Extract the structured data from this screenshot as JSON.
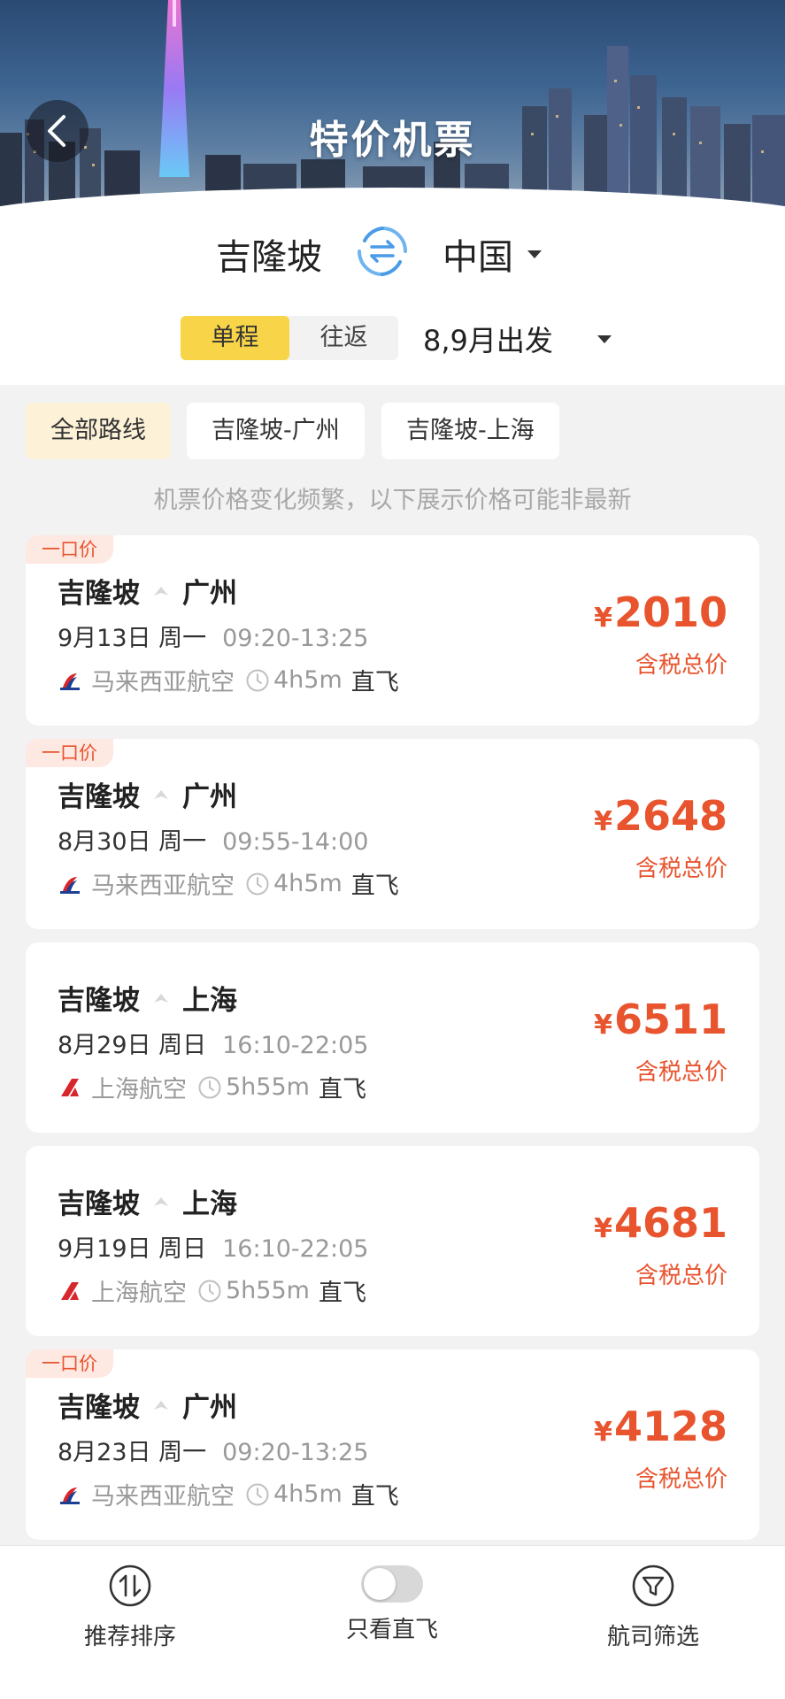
{
  "header": {
    "title": "特价机票",
    "back_icon": "back-arrow-icon"
  },
  "route_selector": {
    "from": "吉隆坡",
    "to": "中国",
    "swap_icon": "swap-arrows-icon",
    "trip_types": [
      {
        "label": "单程",
        "active": true
      },
      {
        "label": "往返",
        "active": false
      }
    ],
    "departure": "8,9月出发"
  },
  "filters": [
    {
      "label": "全部路线",
      "active": true
    },
    {
      "label": "吉隆坡-广州",
      "active": false
    },
    {
      "label": "吉隆坡-上海",
      "active": false
    }
  ],
  "notice": "机票价格变化频繁，以下展示价格可能非最新",
  "flights": [
    {
      "badge": "一口价",
      "from": "吉隆坡",
      "to": "广州",
      "date": "9月13日 周一",
      "time": "09:20-13:25",
      "airline": "马来西亚航空",
      "duration": "4h5m",
      "type": "直飞",
      "currency": "¥",
      "price": "2010",
      "price_note": "含税总价"
    },
    {
      "badge": "一口价",
      "from": "吉隆坡",
      "to": "广州",
      "date": "8月30日 周一",
      "time": "09:55-14:00",
      "airline": "马来西亚航空",
      "duration": "4h5m",
      "type": "直飞",
      "currency": "¥",
      "price": "2648",
      "price_note": "含税总价"
    },
    {
      "badge": "",
      "from": "吉隆坡",
      "to": "上海",
      "date": "8月29日 周日",
      "time": "16:10-22:05",
      "airline": "上海航空",
      "duration": "5h55m",
      "type": "直飞",
      "currency": "¥",
      "price": "6511",
      "price_note": "含税总价"
    },
    {
      "badge": "",
      "from": "吉隆坡",
      "to": "上海",
      "date": "9月19日 周日",
      "time": "16:10-22:05",
      "airline": "上海航空",
      "duration": "5h55m",
      "type": "直飞",
      "currency": "¥",
      "price": "4681",
      "price_note": "含税总价"
    },
    {
      "badge": "一口价",
      "from": "吉隆坡",
      "to": "广州",
      "date": "8月23日 周一",
      "time": "09:20-13:25",
      "airline": "马来西亚航空",
      "duration": "4h5m",
      "type": "直飞",
      "currency": "¥",
      "price": "4128",
      "price_note": "含税总价"
    }
  ],
  "bottom_bar": {
    "sort_label": "推荐排序",
    "direct_only_label": "只看直飞",
    "direct_only_on": false,
    "airline_filter_label": "航司筛选"
  },
  "colors": {
    "accent_yellow": "#f8d548",
    "price_red": "#e8542e",
    "swap_blue": "#4a9be8"
  }
}
